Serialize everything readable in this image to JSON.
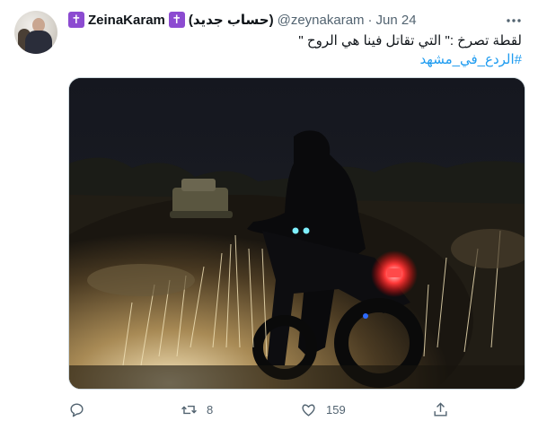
{
  "tweet": {
    "author_name": "ZeinaKaram",
    "author_tag": "(حساب جديد)",
    "handle": "@zeynakaram",
    "separator": "·",
    "date": "Jun 24",
    "text_line1": "لقطة تصرخ  :\" التي تقاتل فينا هي الروح \"",
    "hashtag": "#الردع_في_مشهد",
    "badge_icon": "latin-cross-icon",
    "badge_color": "#8c4bd1"
  },
  "actions": {
    "reply_count": "",
    "retweet_count": "8",
    "like_count": "159",
    "share_count": ""
  },
  "colors": {
    "link": "#1d9bf0",
    "muted": "#536471",
    "text": "#0f1419"
  }
}
